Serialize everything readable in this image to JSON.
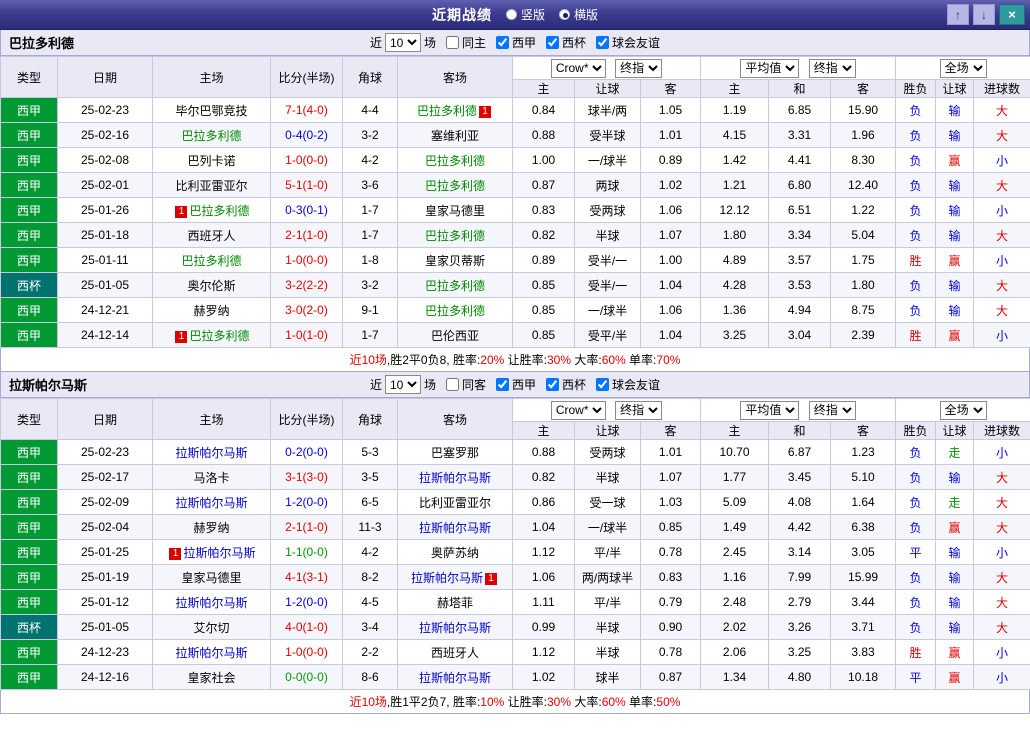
{
  "titlebar": {
    "title": "近期战绩",
    "radios": [
      {
        "label": "竖版",
        "selected": false
      },
      {
        "label": "横版",
        "selected": true
      }
    ],
    "up_icon": "↑",
    "down_icon": "↓",
    "close_icon": "×"
  },
  "colors": {
    "red": "#e60000",
    "blue": "#0000e0",
    "green": "#009900",
    "liga_bg": "#009933",
    "cup_bg": "#00736e",
    "focus_green": "#008800",
    "focus_blue": "#0000cc"
  },
  "header": {
    "type": "类型",
    "date": "日期",
    "home": "主场",
    "score": "比分(半场)",
    "corner": "角球",
    "away": "客场",
    "odds_select": "Crow*",
    "final_select": "终指",
    "avg_select": "平均值",
    "final_select2": "终指",
    "scope_select": "全场",
    "sub": [
      "主",
      "让球",
      "客",
      "主",
      "和",
      "客",
      "胜负",
      "让球",
      "进球数"
    ]
  },
  "sections": [
    {
      "team": "巴拉多利德",
      "focus_color_key": "focus_green",
      "filter": {
        "prefix": "近",
        "count": "10",
        "suffix": "场",
        "checkboxes": [
          {
            "label": "同主",
            "checked": false
          },
          {
            "label": "西甲",
            "checked": true
          },
          {
            "label": "西杯",
            "checked": true
          },
          {
            "label": "球会友谊",
            "checked": true
          }
        ]
      },
      "rows": [
        {
          "league": "西甲",
          "date": "25-02-23",
          "home": "毕尔巴鄂竞技",
          "away": "巴拉多利德",
          "away_focus": true,
          "away_badge": "1",
          "away_badge_pos": "after",
          "score": "7-1(4-0)",
          "score_color": "red",
          "corner": "4-4",
          "o_home": "0.84",
          "handicap": "球半/两",
          "o_away": "1.05",
          "avg_home": "1.19",
          "avg_draw": "6.85",
          "avg_away": "15.90",
          "result": "负",
          "result_color": "blue",
          "cover": "输",
          "cover_color": "blue",
          "goals": "大",
          "goals_color": "red"
        },
        {
          "league": "西甲",
          "date": "25-02-16",
          "home": "巴拉多利德",
          "home_focus": true,
          "away": "塞维利亚",
          "score": "0-4(0-2)",
          "score_color": "blue",
          "corner": "3-2",
          "o_home": "0.88",
          "handicap": "受半球",
          "o_away": "1.01",
          "avg_home": "4.15",
          "avg_draw": "3.31",
          "avg_away": "1.96",
          "result": "负",
          "result_color": "blue",
          "cover": "输",
          "cover_color": "blue",
          "goals": "大",
          "goals_color": "red"
        },
        {
          "league": "西甲",
          "date": "25-02-08",
          "home": "巴列卡诺",
          "away": "巴拉多利德",
          "away_focus": true,
          "score": "1-0(0-0)",
          "score_color": "red",
          "corner": "4-2",
          "o_home": "1.00",
          "handicap": "一/球半",
          "o_away": "0.89",
          "avg_home": "1.42",
          "avg_draw": "4.41",
          "avg_away": "8.30",
          "result": "负",
          "result_color": "blue",
          "cover": "赢",
          "cover_color": "red",
          "goals": "小",
          "goals_color": "blue"
        },
        {
          "league": "西甲",
          "date": "25-02-01",
          "home": "比利亚雷亚尔",
          "away": "巴拉多利德",
          "away_focus": true,
          "score": "5-1(1-0)",
          "score_color": "red",
          "corner": "3-6",
          "o_home": "0.87",
          "handicap": "两球",
          "o_away": "1.02",
          "avg_home": "1.21",
          "avg_draw": "6.80",
          "avg_away": "12.40",
          "result": "负",
          "result_color": "blue",
          "cover": "输",
          "cover_color": "blue",
          "goals": "大",
          "goals_color": "red"
        },
        {
          "league": "西甲",
          "date": "25-01-26",
          "home": "巴拉多利德",
          "home_focus": true,
          "home_badge": "1",
          "home_badge_pos": "before",
          "away": "皇家马德里",
          "score": "0-3(0-1)",
          "score_color": "blue",
          "corner": "1-7",
          "o_home": "0.83",
          "handicap": "受两球",
          "o_away": "1.06",
          "avg_home": "12.12",
          "avg_draw": "6.51",
          "avg_away": "1.22",
          "result": "负",
          "result_color": "blue",
          "cover": "输",
          "cover_color": "blue",
          "goals": "小",
          "goals_color": "blue"
        },
        {
          "league": "西甲",
          "date": "25-01-18",
          "home": "西班牙人",
          "away": "巴拉多利德",
          "away_focus": true,
          "score": "2-1(1-0)",
          "score_color": "red",
          "corner": "1-7",
          "o_home": "0.82",
          "handicap": "半球",
          "o_away": "1.07",
          "avg_home": "1.80",
          "avg_draw": "3.34",
          "avg_away": "5.04",
          "result": "负",
          "result_color": "blue",
          "cover": "输",
          "cover_color": "blue",
          "goals": "大",
          "goals_color": "red"
        },
        {
          "league": "西甲",
          "date": "25-01-11",
          "home": "巴拉多利德",
          "home_focus": true,
          "away": "皇家贝蒂斯",
          "score": "1-0(0-0)",
          "score_color": "red",
          "corner": "1-8",
          "o_home": "0.89",
          "handicap": "受半/一",
          "o_away": "1.00",
          "avg_home": "4.89",
          "avg_draw": "3.57",
          "avg_away": "1.75",
          "result": "胜",
          "result_color": "red",
          "cover": "赢",
          "cover_color": "red",
          "goals": "小",
          "goals_color": "blue"
        },
        {
          "league": "西杯",
          "cup": true,
          "date": "25-01-05",
          "home": "奥尔伦斯",
          "away": "巴拉多利德",
          "away_focus": true,
          "score": "3-2(2-2)",
          "score_color": "red",
          "corner": "3-2",
          "o_home": "0.85",
          "handicap": "受半/一",
          "o_away": "1.04",
          "avg_home": "4.28",
          "avg_draw": "3.53",
          "avg_away": "1.80",
          "result": "负",
          "result_color": "blue",
          "cover": "输",
          "cover_color": "blue",
          "goals": "大",
          "goals_color": "red"
        },
        {
          "league": "西甲",
          "date": "24-12-21",
          "home": "赫罗纳",
          "away": "巴拉多利德",
          "away_focus": true,
          "score": "3-0(2-0)",
          "score_color": "red",
          "corner": "9-1",
          "o_home": "0.85",
          "handicap": "一/球半",
          "o_away": "1.06",
          "avg_home": "1.36",
          "avg_draw": "4.94",
          "avg_away": "8.75",
          "result": "负",
          "result_color": "blue",
          "cover": "输",
          "cover_color": "blue",
          "goals": "大",
          "goals_color": "red"
        },
        {
          "league": "西甲",
          "date": "24-12-14",
          "home": "巴拉多利德",
          "home_focus": true,
          "home_badge": "1",
          "home_badge_pos": "before",
          "away": "巴伦西亚",
          "score": "1-0(1-0)",
          "score_color": "red",
          "corner": "1-7",
          "o_home": "0.85",
          "handicap": "受平/半",
          "o_away": "1.04",
          "avg_home": "3.25",
          "avg_draw": "3.04",
          "avg_away": "2.39",
          "result": "胜",
          "result_color": "red",
          "cover": "赢",
          "cover_color": "red",
          "goals": "小",
          "goals_color": "blue"
        }
      ],
      "summary": [
        {
          "text": "近10场",
          "color": "red"
        },
        {
          "text": ",胜2平0负8, 胜率:",
          "color": "black"
        },
        {
          "text": "20%",
          "color": "red"
        },
        {
          "text": " 让胜率:",
          "color": "black"
        },
        {
          "text": "30%",
          "color": "red"
        },
        {
          "text": " 大率:",
          "color": "black"
        },
        {
          "text": "60%",
          "color": "red"
        },
        {
          "text": " 单率:",
          "color": "black"
        },
        {
          "text": "70%",
          "color": "red"
        }
      ]
    },
    {
      "team": "拉斯帕尔马斯",
      "focus_color_key": "focus_blue",
      "filter": {
        "prefix": "近",
        "count": "10",
        "suffix": "场",
        "checkboxes": [
          {
            "label": "同客",
            "checked": false
          },
          {
            "label": "西甲",
            "checked": true
          },
          {
            "label": "西杯",
            "checked": true
          },
          {
            "label": "球会友谊",
            "checked": true
          }
        ]
      },
      "rows": [
        {
          "league": "西甲",
          "date": "25-02-23",
          "home": "拉斯帕尔马斯",
          "home_focus": true,
          "away": "巴塞罗那",
          "score": "0-2(0-0)",
          "score_color": "blue",
          "corner": "5-3",
          "o_home": "0.88",
          "handicap": "受两球",
          "o_away": "1.01",
          "avg_home": "10.70",
          "avg_draw": "6.87",
          "avg_away": "1.23",
          "result": "负",
          "result_color": "blue",
          "cover": "走",
          "cover_color": "green",
          "goals": "小",
          "goals_color": "blue"
        },
        {
          "league": "西甲",
          "date": "25-02-17",
          "home": "马洛卡",
          "away": "拉斯帕尔马斯",
          "away_focus": true,
          "score": "3-1(3-0)",
          "score_color": "red",
          "corner": "3-5",
          "o_home": "0.82",
          "handicap": "半球",
          "o_away": "1.07",
          "avg_home": "1.77",
          "avg_draw": "3.45",
          "avg_away": "5.10",
          "result": "负",
          "result_color": "blue",
          "cover": "输",
          "cover_color": "blue",
          "goals": "大",
          "goals_color": "red"
        },
        {
          "league": "西甲",
          "date": "25-02-09",
          "home": "拉斯帕尔马斯",
          "home_focus": true,
          "away": "比利亚雷亚尔",
          "score": "1-2(0-0)",
          "score_color": "blue",
          "corner": "6-5",
          "o_home": "0.86",
          "handicap": "受一球",
          "o_away": "1.03",
          "avg_home": "5.09",
          "avg_draw": "4.08",
          "avg_away": "1.64",
          "result": "负",
          "result_color": "blue",
          "cover": "走",
          "cover_color": "green",
          "goals": "大",
          "goals_color": "red"
        },
        {
          "league": "西甲",
          "date": "25-02-04",
          "home": "赫罗纳",
          "away": "拉斯帕尔马斯",
          "away_focus": true,
          "score": "2-1(1-0)",
          "score_color": "red",
          "corner": "11-3",
          "o_home": "1.04",
          "handicap": "一/球半",
          "o_away": "0.85",
          "avg_home": "1.49",
          "avg_draw": "4.42",
          "avg_away": "6.38",
          "result": "负",
          "result_color": "blue",
          "cover": "赢",
          "cover_color": "red",
          "goals": "大",
          "goals_color": "red"
        },
        {
          "league": "西甲",
          "date": "25-01-25",
          "home": "拉斯帕尔马斯",
          "home_focus": true,
          "home_badge": "1",
          "home_badge_pos": "before",
          "away": "奥萨苏纳",
          "score": "1-1(0-0)",
          "score_color": "green",
          "corner": "4-2",
          "o_home": "1.12",
          "handicap": "平/半",
          "o_away": "0.78",
          "avg_home": "2.45",
          "avg_draw": "3.14",
          "avg_away": "3.05",
          "result": "平",
          "result_color": "blue",
          "cover": "输",
          "cover_color": "blue",
          "goals": "小",
          "goals_color": "blue"
        },
        {
          "league": "西甲",
          "date": "25-01-19",
          "home": "皇家马德里",
          "away": "拉斯帕尔马斯",
          "away_focus": true,
          "away_badge": "1",
          "away_badge_pos": "after",
          "score": "4-1(3-1)",
          "score_color": "red",
          "corner": "8-2",
          "o_home": "1.06",
          "handicap": "两/两球半",
          "o_away": "0.83",
          "avg_home": "1.16",
          "avg_draw": "7.99",
          "avg_away": "15.99",
          "result": "负",
          "result_color": "blue",
          "cover": "输",
          "cover_color": "blue",
          "goals": "大",
          "goals_color": "red"
        },
        {
          "league": "西甲",
          "date": "25-01-12",
          "home": "拉斯帕尔马斯",
          "home_focus": true,
          "away": "赫塔菲",
          "score": "1-2(0-0)",
          "score_color": "blue",
          "corner": "4-5",
          "o_home": "1.11",
          "handicap": "平/半",
          "o_away": "0.79",
          "avg_home": "2.48",
          "avg_draw": "2.79",
          "avg_away": "3.44",
          "result": "负",
          "result_color": "blue",
          "cover": "输",
          "cover_color": "blue",
          "goals": "大",
          "goals_color": "red"
        },
        {
          "league": "西杯",
          "cup": true,
          "date": "25-01-05",
          "home": "艾尔切",
          "away": "拉斯帕尔马斯",
          "away_focus": true,
          "score": "4-0(1-0)",
          "score_color": "red",
          "corner": "3-4",
          "o_home": "0.99",
          "handicap": "半球",
          "o_away": "0.90",
          "avg_home": "2.02",
          "avg_draw": "3.26",
          "avg_away": "3.71",
          "result": "负",
          "result_color": "blue",
          "cover": "输",
          "cover_color": "blue",
          "goals": "大",
          "goals_color": "red"
        },
        {
          "league": "西甲",
          "date": "24-12-23",
          "home": "拉斯帕尔马斯",
          "home_focus": true,
          "away": "西班牙人",
          "score": "1-0(0-0)",
          "score_color": "red",
          "corner": "2-2",
          "o_home": "1.12",
          "handicap": "半球",
          "o_away": "0.78",
          "avg_home": "2.06",
          "avg_draw": "3.25",
          "avg_away": "3.83",
          "result": "胜",
          "result_color": "red",
          "cover": "赢",
          "cover_color": "red",
          "goals": "小",
          "goals_color": "blue"
        },
        {
          "league": "西甲",
          "date": "24-12-16",
          "home": "皇家社会",
          "away": "拉斯帕尔马斯",
          "away_focus": true,
          "score": "0-0(0-0)",
          "score_color": "green",
          "corner": "8-6",
          "o_home": "1.02",
          "handicap": "球半",
          "o_away": "0.87",
          "avg_home": "1.34",
          "avg_draw": "4.80",
          "avg_away": "10.18",
          "result": "平",
          "result_color": "blue",
          "cover": "赢",
          "cover_color": "red",
          "goals": "小",
          "goals_color": "blue"
        }
      ],
      "summary": [
        {
          "text": "近10场",
          "color": "red"
        },
        {
          "text": ",胜1平2负7, 胜率:",
          "color": "black"
        },
        {
          "text": "10%",
          "color": "red"
        },
        {
          "text": " 让胜率:",
          "color": "black"
        },
        {
          "text": "30%",
          "color": "red"
        },
        {
          "text": " 大率:",
          "color": "black"
        },
        {
          "text": "60%",
          "color": "red"
        },
        {
          "text": " 单率:",
          "color": "black"
        },
        {
          "text": "50%",
          "color": "red"
        }
      ]
    }
  ]
}
